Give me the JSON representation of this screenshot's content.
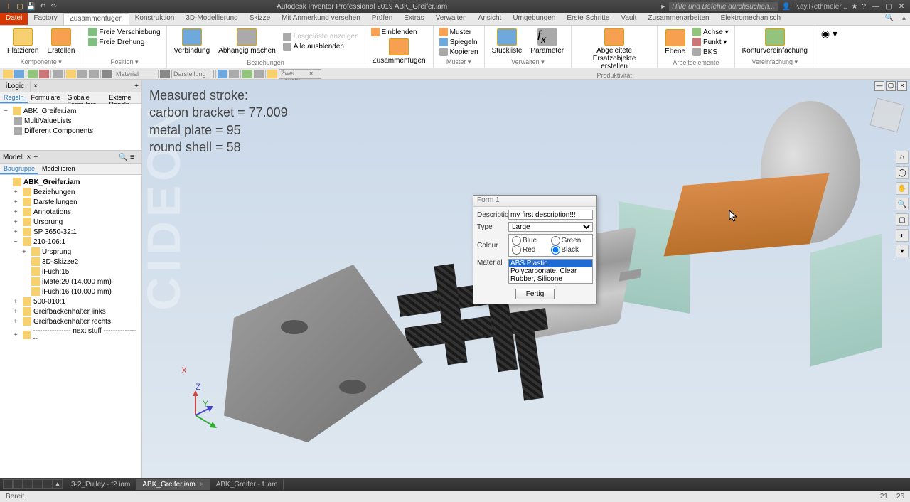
{
  "title": "Autodesk Inventor Professional 2019   ABK_Greifer.iam",
  "search_placeholder": "Hilfe und Befehle durchsuchen...",
  "username": "Kay.Rethmeier...",
  "ribbon_tabs": {
    "file": "Datei",
    "items": [
      "Factory",
      "Zusammenfügen",
      "Konstruktion",
      "3D-Modellierung",
      "Skizze",
      "Mit Anmerkung versehen",
      "Prüfen",
      "Extras",
      "Verwalten",
      "Ansicht",
      "Umgebungen",
      "Erste Schritte",
      "Vault",
      "Zusammenarbeiten",
      "Elektromechanisch"
    ],
    "active_index": 1
  },
  "ribbon": {
    "g1": {
      "b1": "Platzieren",
      "b2": "Erstellen",
      "s1": "Freie Verschiebung",
      "s2": "Freie Drehung",
      "label": "Komponente ▾",
      "label2": "Position ▾"
    },
    "g2": {
      "b1": "Verbindung",
      "b2": "Abhängig machen",
      "s1": "Losgelöste anzeigen",
      "s2": "Alle ausblenden",
      "label": "Beziehungen"
    },
    "g3": {
      "s1": "Einblenden",
      "b1": "Zusammenfügen"
    },
    "g4": {
      "b1": "Muster",
      "b2": "Spiegeln",
      "b3": "Kopieren",
      "label": "Muster ▾"
    },
    "g5": {
      "b1": "Stückliste",
      "b2": "Parameter",
      "label": "Verwalten ▾"
    },
    "g6": {
      "b1": "Abgeleitete Ersatzobjekte erstellen",
      "label": "Produktivität"
    },
    "g7": {
      "b1": "Ebene",
      "s1": "Achse ▾",
      "s2": "Punkt ▾",
      "s3": "BKS",
      "label": "Arbeitselemente"
    },
    "g8": {
      "b1": "Konturvereinfachung",
      "label": "Vereinfachung ▾"
    }
  },
  "qat": {
    "material": "Material",
    "display": "Darstellung",
    "viewcombo": "Zwei Leucht..."
  },
  "ilogic_panel": {
    "title": "iLogic",
    "tabs": [
      "Regeln",
      "Formulare",
      "Globale Formulare",
      "Externe Regeln"
    ],
    "tree": {
      "root": "ABK_Greifer.iam",
      "items": [
        "MultiValueLists",
        "Different Components"
      ]
    }
  },
  "model_panel": {
    "title": "Modell",
    "tabs": [
      "Baugruppe",
      "Modellieren"
    ],
    "root": "ABK_Greifer.iam",
    "items": [
      {
        "label": "Beziehungen",
        "indent": 1,
        "exp": "+",
        "icon": "b"
      },
      {
        "label": "Darstellungen",
        "indent": 1,
        "exp": "+",
        "icon": "g"
      },
      {
        "label": "Annotations",
        "indent": 1,
        "exp": "+",
        "icon": "g"
      },
      {
        "label": "Ursprung",
        "indent": 1,
        "exp": "+",
        "icon": "g"
      },
      {
        "label": "SP 3650-32:1",
        "indent": 1,
        "exp": "+",
        "icon": "y"
      },
      {
        "label": "210-106:1",
        "indent": 1,
        "exp": "−",
        "icon": "y"
      },
      {
        "label": "Ursprung",
        "indent": 2,
        "exp": "+",
        "icon": "g"
      },
      {
        "label": "3D-Skizze2",
        "indent": 2,
        "exp": "",
        "icon": "g"
      },
      {
        "label": "iFush:15",
        "indent": 2,
        "exp": "",
        "icon": "b"
      },
      {
        "label": "iMate:29 (14,000 mm)",
        "indent": 2,
        "exp": "",
        "icon": "b"
      },
      {
        "label": "iFush:16 (10,000 mm)",
        "indent": 2,
        "exp": "",
        "icon": "b"
      },
      {
        "label": "500-010:1",
        "indent": 1,
        "exp": "+",
        "icon": "y"
      },
      {
        "label": "Greifbackenhalter links",
        "indent": 1,
        "exp": "+",
        "icon": "y"
      },
      {
        "label": "Greifbackenhalter rechts",
        "indent": 1,
        "exp": "+",
        "icon": "y"
      },
      {
        "label": "---------------- next stuff ----------------",
        "indent": 1,
        "exp": "+",
        "icon": "y"
      }
    ]
  },
  "viewport": {
    "overlay": {
      "l1": "Measured stroke:",
      "l2": "carbon bracket = 77.009",
      "l3": "metal plate = 95",
      "l4": "round shell = 58"
    },
    "watermark": "CIDEON"
  },
  "form": {
    "title": "Form 1",
    "desc_label": "Description",
    "desc_value": "my first description!!!",
    "type_label": "Type",
    "type_value": "Large",
    "colour_label": "Colour",
    "colours": {
      "c1": "Blue",
      "c2": "Green",
      "c3": "Red",
      "c4": "Black"
    },
    "colour_selected": "Black",
    "material_label": "Material",
    "materials": [
      "ABS Plastic",
      "Polycarbonate, Clear",
      "Rubber, Silicone"
    ],
    "material_selected": 0,
    "done": "Fertig"
  },
  "doc_tabs": {
    "t1": "3-2_Pulley - f2.iam",
    "t2": "ABK_Greifer.iam",
    "t3": "ABK_Greifer - f.iam"
  },
  "status": {
    "left": "Bereit",
    "r1": "21",
    "r2": "26"
  }
}
